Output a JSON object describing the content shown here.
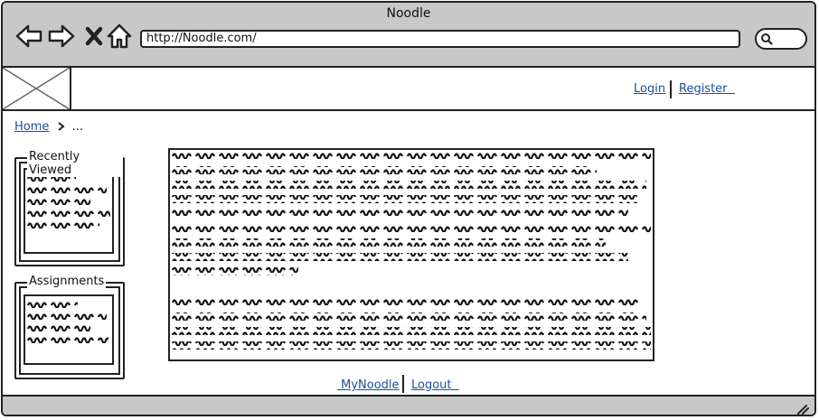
{
  "window": {
    "title": "Noodle"
  },
  "toolbar": {
    "back_icon": "arrow-left-icon",
    "forward_icon": "arrow-right-icon",
    "stop_icon": "close-icon",
    "home_icon": "home-icon",
    "url": "http://Noodle.com/",
    "search_icon": "search-icon"
  },
  "header": {
    "logo_icon": "image-placeholder-icon",
    "login_label": "Login",
    "register_label": "Register"
  },
  "breadcrumb": {
    "home_label": "Home",
    "more": "..."
  },
  "sidebar": {
    "recently_viewed_title": "Recently Viewed",
    "assignments_title": "Assignments"
  },
  "footer": {
    "mynoodle_label": "MyNoodle",
    "logout_label": "Logout"
  },
  "statusbar": {
    "resize_icon": "resize-grip-icon"
  }
}
